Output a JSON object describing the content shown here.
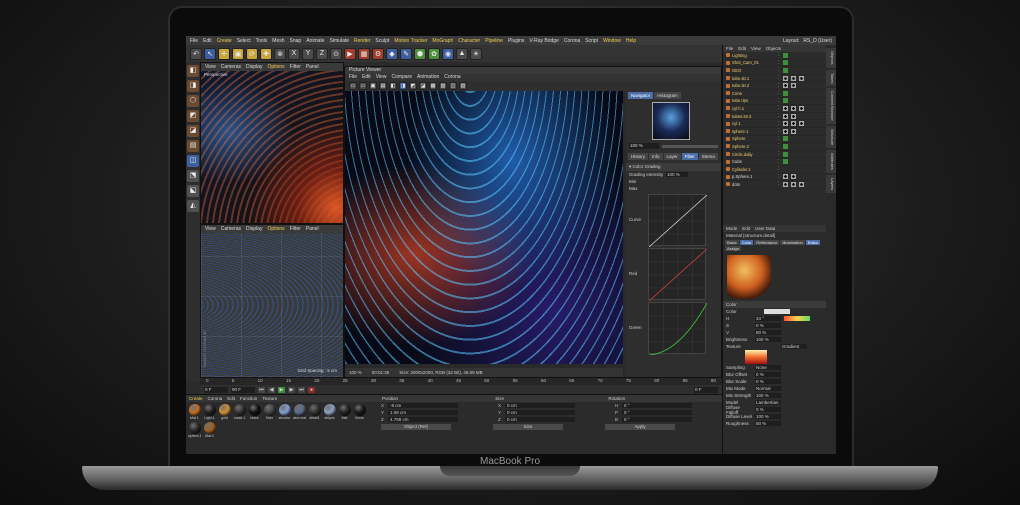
{
  "device": {
    "brand": "MacBook Pro"
  },
  "menubar": {
    "items": [
      "File",
      "Edit",
      "Create",
      "Select",
      "Tools",
      "Mesh",
      "Snap",
      "Animate",
      "Simulate",
      "Render",
      "Sculpt",
      "Motion Tracker",
      "MoGraph",
      "Character",
      "Pipeline",
      "Plugins",
      "V-Ray Bridge",
      "Corona",
      "Script",
      "Window",
      "Help"
    ],
    "highlighted": [
      "Create",
      "Render",
      "Motion Tracker",
      "MoGraph",
      "Character",
      "Pipeline",
      "Window",
      "Help"
    ],
    "layout_label": "Layout:",
    "layout_value": "RS_D (User)"
  },
  "toolbar": {
    "buttons": [
      {
        "glyph": "↶",
        "color": "gray",
        "name": "undo"
      },
      {
        "glyph": "↖",
        "color": "blue",
        "name": "live-selection"
      },
      {
        "glyph": "✛",
        "color": "yellow",
        "name": "move"
      },
      {
        "glyph": "▣",
        "color": "yellow",
        "name": "scale"
      },
      {
        "glyph": "⟳",
        "color": "yellow",
        "name": "rotate"
      },
      {
        "glyph": "✚",
        "color": "yellow",
        "name": "add"
      },
      {
        "glyph": "⊗",
        "color": "gray",
        "name": "model"
      },
      {
        "glyph": "X",
        "color": "gray",
        "name": "x-axis"
      },
      {
        "glyph": "Y",
        "color": "gray",
        "name": "y-axis"
      },
      {
        "glyph": "Z",
        "color": "gray",
        "name": "z-axis"
      },
      {
        "glyph": "⊙",
        "color": "gray",
        "name": "coordinate-system"
      },
      {
        "glyph": "▶",
        "color": "red",
        "name": "render-view"
      },
      {
        "glyph": "▦",
        "color": "red",
        "name": "render-picture-viewer"
      },
      {
        "glyph": "⚙",
        "color": "red",
        "name": "render-settings"
      },
      {
        "glyph": "◆",
        "color": "blue",
        "name": "cube"
      },
      {
        "glyph": "✎",
        "color": "blue",
        "name": "pen"
      },
      {
        "glyph": "⬢",
        "color": "green",
        "name": "subdivision"
      },
      {
        "glyph": "✿",
        "color": "green",
        "name": "cloner"
      },
      {
        "glyph": "◉",
        "color": "blue",
        "name": "deformer"
      },
      {
        "glyph": "▲",
        "color": "gray",
        "name": "environment"
      },
      {
        "glyph": "☀",
        "color": "gray",
        "name": "light"
      }
    ]
  },
  "left_tools": [
    "◧",
    "◨",
    "⬡",
    "◩",
    "◪",
    "▤",
    "◫",
    "⬔",
    "⬕",
    "◭"
  ],
  "viewport_top": {
    "menu": [
      "View",
      "Cameras",
      "Display",
      "Options",
      "Filter",
      "Panel"
    ],
    "active": "Options",
    "label": "Perspective"
  },
  "viewport_bottom": {
    "menu": [
      "View",
      "Cameras",
      "Display",
      "Options",
      "Filter",
      "Panel"
    ],
    "active": "Options",
    "grid_spacing": "Grid Spacing : 5 cm",
    "watermark": "MAXON CINEMA 4D"
  },
  "picture_viewer": {
    "title": "Picture Viewer",
    "menu": [
      "File",
      "Edit",
      "View",
      "Compare",
      "Animation",
      "Corona"
    ],
    "tools": 12,
    "status": {
      "zoom": "100 %",
      "time": "00:01:36",
      "size": "Size: 2000x2000, RGB (32 Bit), 48.09 MB"
    },
    "side": {
      "tabs_top": [
        "Navigator",
        "Histogram"
      ],
      "active_top": "Navigator",
      "zoom": "100 %",
      "tabs_mid": [
        "History",
        "Info",
        "Layer",
        "Filter",
        "Stereo"
      ],
      "active_mid": "Filter",
      "section": "Color Grading",
      "grading_intensity_label": "Grading Intensity",
      "grading_intensity_value": "100 %",
      "min_label": "Min",
      "max_label": "Max",
      "curves": [
        "Curve",
        "Red",
        "Green"
      ],
      "curve_colors": [
        "#d0d0d0",
        "#d04040",
        "#40c040"
      ]
    }
  },
  "timeline": {
    "ticks": [
      "0",
      "5",
      "10",
      "15",
      "20",
      "25",
      "30",
      "35",
      "40",
      "45",
      "50",
      "55",
      "60",
      "65",
      "70",
      "75",
      "80",
      "85",
      "90"
    ],
    "start": "0 F",
    "end": "90 F",
    "current": "0 F"
  },
  "materials": {
    "menu": [
      "Create",
      "Corona",
      "Edit",
      "Function",
      "Texture"
    ],
    "active": "Create",
    "items": [
      {
        "label": "Mat.1",
        "color": "#c07020"
      },
      {
        "label": "Light.1",
        "color": "#202020"
      },
      {
        "label": "gold",
        "color": "#d09030"
      },
      {
        "label": "mask.1",
        "color": "#303030"
      },
      {
        "label": "black",
        "color": "#101010"
      },
      {
        "label": "Holo",
        "color": "#404040"
      },
      {
        "label": "structur",
        "color": "#80a0d0"
      },
      {
        "label": "wire.mat",
        "color": "#5a6a8a"
      },
      {
        "label": "detail1",
        "color": "#303030"
      },
      {
        "label": "stripes",
        "color": "#90a0c0"
      },
      {
        "label": "Mat",
        "color": "#202020"
      },
      {
        "label": "floors",
        "color": "#181818"
      },
      {
        "label": "sphere.1",
        "color": "#282828"
      },
      {
        "label": "Mat.2",
        "color": "#a06020"
      }
    ]
  },
  "coordinates": {
    "headers": [
      "Position",
      "Size",
      "Rotation"
    ],
    "rows": [
      {
        "axis": "X",
        "pos": "-8 cm",
        "size": "0 cm",
        "rot_axis": "H",
        "rot": "0 °"
      },
      {
        "axis": "Y",
        "pos": "1.08 cm",
        "size": "0 cm",
        "rot_axis": "P",
        "rot": "0 °"
      },
      {
        "axis": "Z",
        "pos": "4.769 cm",
        "size": "0 cm",
        "rot_axis": "B",
        "rot": "0 °"
      }
    ],
    "mode_object": "Object (Rel)",
    "mode_size": "Size",
    "apply": "Apply"
  },
  "object_manager": {
    "menu": [
      "File",
      "Edit",
      "View",
      "Objects"
    ],
    "rows": [
      {
        "name": "Lighting",
        "color": "yellow",
        "tags": [
          "check"
        ]
      },
      {
        "name": "Shot_Cam_01",
        "color": "yellow",
        "tags": [
          "check"
        ]
      },
      {
        "name": "GEO",
        "color": "yellow",
        "tags": [
          "check"
        ]
      },
      {
        "name": "tube.str.1",
        "color": "yellow",
        "tags": [
          "dark",
          "dark",
          "dark"
        ]
      },
      {
        "name": "tube.str.2",
        "color": "yellow",
        "tags": [
          "dark",
          "dark"
        ]
      },
      {
        "name": "Cone",
        "color": "yellow",
        "tags": [
          "check"
        ]
      },
      {
        "name": "tube.rips",
        "color": "yellow",
        "tags": [
          "check"
        ]
      },
      {
        "name": "cyl.h.1",
        "color": "yellow",
        "tags": [
          "dark",
          "dark",
          "dark"
        ]
      },
      {
        "name": "tubes.str.3",
        "color": "yellow",
        "tags": [
          "dark",
          "dark"
        ]
      },
      {
        "name": "cyl.1",
        "color": "yellow",
        "tags": [
          "dark",
          "dark",
          "dark"
        ]
      },
      {
        "name": "sphere.1",
        "color": "yellow",
        "tags": [
          "dark",
          "dark"
        ]
      },
      {
        "name": "Sphere",
        "color": "yellow",
        "tags": [
          "check"
        ]
      },
      {
        "name": "Sphere.2",
        "color": "yellow",
        "tags": [
          "check"
        ]
      },
      {
        "name": "Circle.daily",
        "color": "yellow",
        "tags": [
          "check"
        ]
      },
      {
        "name": "Cube",
        "color": "white",
        "tags": [
          "check"
        ]
      },
      {
        "name": "Cylinder.1",
        "color": "yellow",
        "tags": []
      },
      {
        "name": "p.Sphere.1",
        "color": "white",
        "tags": [
          "dark",
          "dark"
        ]
      },
      {
        "name": "dots",
        "color": "white",
        "tags": [
          "dark",
          "dark",
          "dark"
        ]
      }
    ]
  },
  "attributes": {
    "menu": [
      "Mode",
      "Edit",
      "User Data"
    ],
    "material_name": "Material [structure.detail]",
    "tabs": [
      "Basic",
      "Color",
      "Reflectance",
      "Illumination",
      "Editor",
      "Assign"
    ],
    "active_tabs": [
      "Color",
      "Editor"
    ],
    "section_color": "Color",
    "color_label": "Color",
    "h_label": "H",
    "h_value": "34 °",
    "s_label": "S",
    "s_value": "0 %",
    "v_label": "V",
    "v_value": "80 %",
    "brightness_label": "Brightness",
    "brightness_value": "100 %",
    "texture_label": "Texture",
    "texture_value": "Gradient",
    "sampling_label": "Sampling",
    "sampling_value": "None",
    "blur_offset_label": "Blur Offset",
    "blur_offset_value": "0 %",
    "blur_scale_label": "Blur Scale",
    "blur_scale_value": "0 %",
    "mix_mode_label": "Mix Mode",
    "mix_mode_value": "Normal",
    "mix_strength_label": "Mix Strength",
    "mix_strength_value": "100 %",
    "model_label": "Model",
    "model_value": "Lambertian",
    "diffuse_falloff_label": "Diffuse Falloff",
    "diffuse_falloff_value": "0 %",
    "diffuse_level_label": "Diffuse Level",
    "diffuse_level_value": "100 %",
    "roughness_label": "Roughness",
    "roughness_value": "50 %"
  },
  "side_tabs": [
    "Objects",
    "Takes",
    "Content Browser",
    "Structure",
    "Attributes",
    "Layers"
  ]
}
